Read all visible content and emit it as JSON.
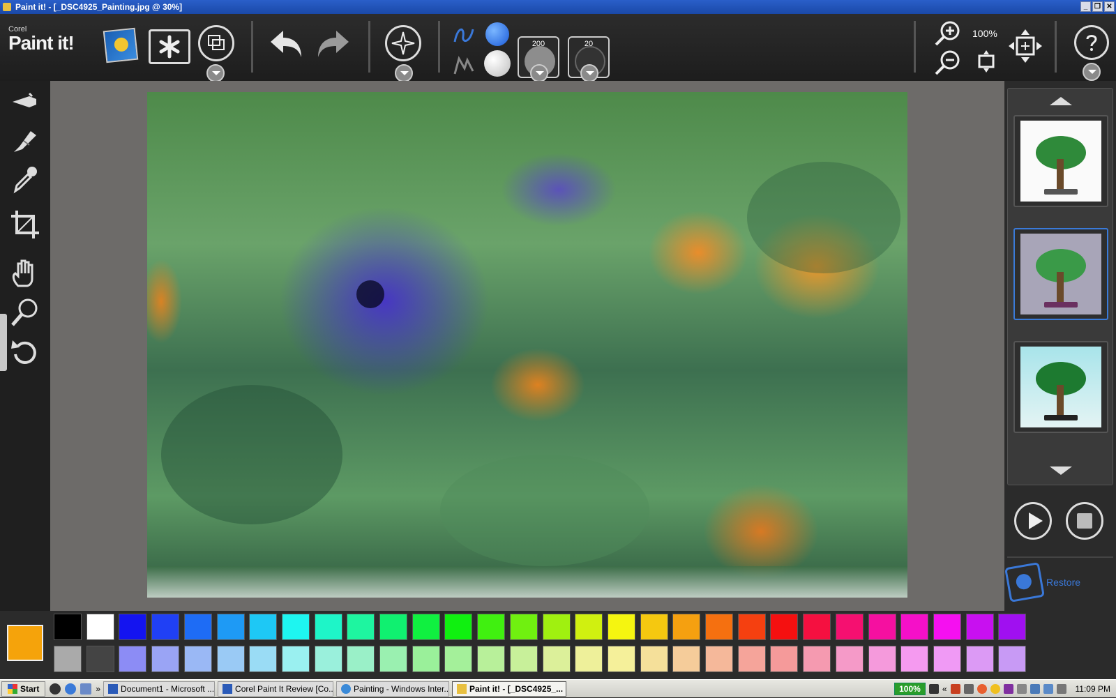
{
  "window": {
    "title": "Paint it! - [_DSC4925_Painting.jpg @ 30%]",
    "controls": [
      "_",
      "❐",
      "✕"
    ]
  },
  "logo": {
    "brand": "Corel",
    "name": "Paint it!"
  },
  "toolbar": {
    "brush_size": "200",
    "brush_detail": "20",
    "zoom_level": "100%",
    "icons": [
      "auto-paint-icon",
      "save-icon",
      "undo-icon",
      "redo-icon",
      "compass-icon",
      "stroke-style-icon",
      "brush-color-icon",
      "zoom-in-icon",
      "zoom-out-icon",
      "fit-screen-icon",
      "full-screen-icon",
      "help-icon"
    ]
  },
  "tools": [
    "airbrush-icon",
    "brush-icon",
    "eyedropper-icon",
    "crop-icon",
    "hand-icon",
    "magnifier-icon",
    "rotate-icon"
  ],
  "presets": {
    "selected_index": 1
  },
  "restore": {
    "label": "Restore"
  },
  "palette": {
    "current": "#f5a30b",
    "row1": [
      "#000000",
      "#ffffff",
      "#1414f0",
      "#2040f5",
      "#1e6cf5",
      "#1e9af5",
      "#1ec8f5",
      "#1ef5f0",
      "#1ef5c8",
      "#1ef5a0",
      "#10f070",
      "#10f040",
      "#10f010",
      "#40f010",
      "#70f010",
      "#a0f010",
      "#d0f010",
      "#f5f510",
      "#f5c810",
      "#f5a010",
      "#f57010",
      "#f54010",
      "#f51010",
      "#f51040",
      "#f51070",
      "#f510a0",
      "#f510c8",
      "#f510f0",
      "#c810f0",
      "#a010f0"
    ],
    "row2": [
      "#aaaaaa",
      "#444444",
      "#8c8cf5",
      "#9aa4f5",
      "#9ab8f5",
      "#9acaf5",
      "#9adcf5",
      "#9af0f0",
      "#9af0dc",
      "#9af0c8",
      "#9af0b0",
      "#9af09a",
      "#a4f09a",
      "#b8f09a",
      "#c8f09a",
      "#dcf09a",
      "#eef09a",
      "#f5f09a",
      "#f5e09a",
      "#f5cc9a",
      "#f5b89a",
      "#f5a49a",
      "#f59a9a",
      "#f59ab0",
      "#f59ac8",
      "#f59adc",
      "#f59af0",
      "#f09af5",
      "#dc9af5",
      "#c89af5"
    ]
  },
  "taskbar": {
    "start": "Start",
    "tasks": [
      {
        "label": "Document1 - Microsoft ...",
        "active": false
      },
      {
        "label": "Corel Paint It Review [Co...",
        "active": false
      },
      {
        "label": "Painting - Windows Inter...",
        "active": false
      },
      {
        "label": "Paint it! - [_DSC4925_...",
        "active": true
      }
    ],
    "overflow": "»",
    "battery": "100%",
    "tray_overflow": "«",
    "clock": "11:09 PM"
  }
}
